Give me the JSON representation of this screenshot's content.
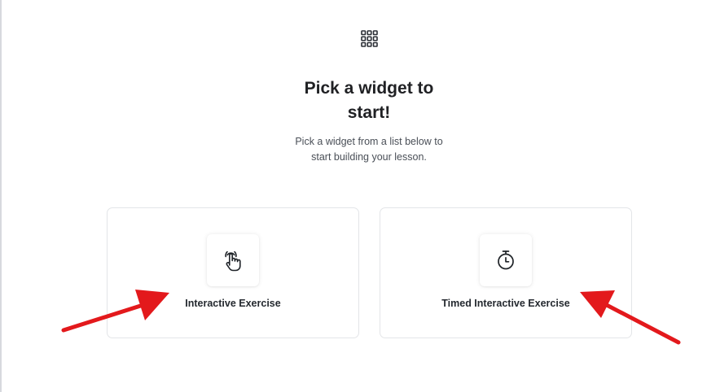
{
  "header": {
    "icon": "grid-icon",
    "title_line1": "Pick a widget to",
    "title_line2": "start!",
    "subtitle_line1": "Pick a widget from a list below to",
    "subtitle_line2": "start building your lesson."
  },
  "widgets": [
    {
      "label": "Interactive Exercise",
      "icon": "hand-tap-icon"
    },
    {
      "label": "Timed Interactive Exercise",
      "icon": "stopwatch-icon"
    }
  ],
  "annotations": {
    "arrow_color": "#e3191c"
  }
}
